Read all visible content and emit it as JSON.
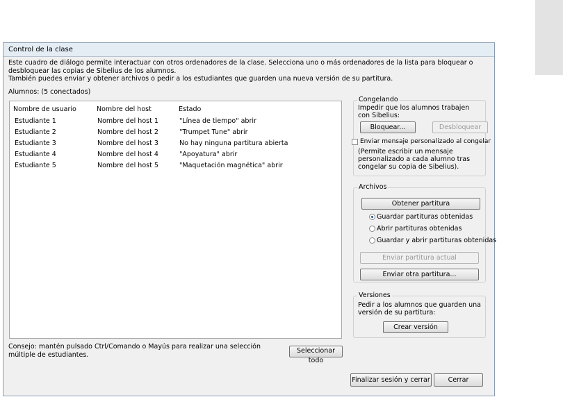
{
  "dialog": {
    "title": "Control de la clase",
    "intro_line1": "Este cuadro de diálogo permite interactuar con otros ordenadores de la clase. Selecciona uno o más ordenadores de la lista para bloquear o desbloquear las copias de Sibelius de los alumnos.",
    "intro_line2": "También puedes enviar y obtener archivos o pedir a los estudiantes que guarden una nueva versión de su partitura.",
    "students_label": "Alumnos: (5 conectados)"
  },
  "table": {
    "columns": [
      "Nombre de usuario",
      "Nombre del host",
      "Estado"
    ],
    "rows": [
      [
        "Estudiante 1",
        "Nombre del host 1",
        "\"Línea de tiempo\" abrir"
      ],
      [
        "Estudiante 2",
        "Nombre del host 2",
        "\"Trumpet Tune\" abrir"
      ],
      [
        "Estudiante 3",
        "Nombre del host 3",
        "No hay ninguna partitura abierta"
      ],
      [
        "Estudiante 4",
        "Nombre del host 4",
        "\"Apoyatura\" abrir"
      ],
      [
        "Estudiante 5",
        "Nombre del host 5",
        "\"Maquetación magnética\" abrir"
      ]
    ]
  },
  "tip": "Consejo: mantén pulsado Ctrl/Comando o Mayús para realizar una selección múltiple de estudiantes.",
  "select_all_button": "Seleccionar todo",
  "freeze": {
    "title": "Congelando",
    "description": "Impedir que los alumnos trabajen con Sibelius:",
    "lock_button": "Bloquear...",
    "unlock_button": "Desbloquear",
    "custom_message_checkbox": "Enviar mensaje personalizado al congelar",
    "custom_message_checked": false,
    "note": "(Permite escribir un mensaje personalizado a cada alumno tras congelar su copia de Sibelius)."
  },
  "files": {
    "title": "Archivos",
    "get_score_button": "Obtener partitura",
    "radio_options": [
      "Guardar partituras obtenidas",
      "Abrir partituras obtenidas",
      "Guardar y abrir partituras obtenidas"
    ],
    "selected_option": 0,
    "send_current_button": "Enviar partitura actual",
    "send_other_button": "Enviar otra partitura..."
  },
  "versions": {
    "title": "Versiones",
    "description": "Pedir a los alumnos que guarden una versión de su partitura:",
    "create_button": "Crear versión"
  },
  "footer": {
    "end_session_button": "Finalizar sesión y cerrar",
    "close_button": "Cerrar"
  }
}
